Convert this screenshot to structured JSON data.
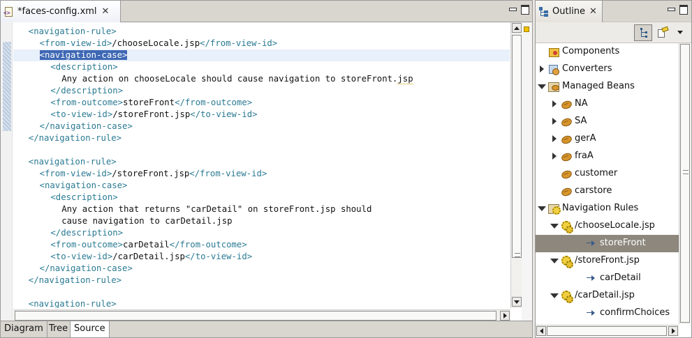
{
  "editor": {
    "tab_title": "*faces-config.xml",
    "bottom_tabs": [
      "Diagram",
      "Tree",
      "Source"
    ],
    "active_bottom_tab": "Source",
    "lines": [
      {
        "indent": 1,
        "parts": [
          [
            "t",
            "<navigation-rule>"
          ]
        ]
      },
      {
        "indent": 2,
        "parts": [
          [
            "t",
            "<from-view-id>"
          ],
          [
            "v",
            "/chooseLocale.jsp"
          ],
          [
            "t",
            "</from-view-id>"
          ]
        ]
      },
      {
        "indent": 2,
        "current": true,
        "parts": [
          [
            "sel",
            "<navigation-case>"
          ]
        ]
      },
      {
        "indent": 3,
        "parts": [
          [
            "t",
            "<description>"
          ]
        ]
      },
      {
        "indent": 4,
        "parts": [
          [
            "v",
            "Any action on chooseLocale should cause navigation to storeFront."
          ],
          [
            "squig",
            "jsp"
          ]
        ]
      },
      {
        "indent": 3,
        "parts": [
          [
            "t",
            "</description>"
          ]
        ]
      },
      {
        "indent": 3,
        "parts": [
          [
            "t",
            "<from-outcome>"
          ],
          [
            "v",
            "storeFront"
          ],
          [
            "t",
            "</from-outcome>"
          ]
        ]
      },
      {
        "indent": 3,
        "parts": [
          [
            "t",
            "<to-view-id>"
          ],
          [
            "v",
            "/storeFront.jsp"
          ],
          [
            "t",
            "</to-view-id>"
          ]
        ]
      },
      {
        "indent": 2,
        "parts": [
          [
            "t",
            "</navigation-case>"
          ]
        ]
      },
      {
        "indent": 1,
        "parts": [
          [
            "t",
            "</navigation-rule>"
          ]
        ]
      },
      {
        "indent": 0,
        "parts": []
      },
      {
        "indent": 1,
        "parts": [
          [
            "t",
            "<navigation-rule>"
          ]
        ]
      },
      {
        "indent": 2,
        "parts": [
          [
            "t",
            "<from-view-id>"
          ],
          [
            "v",
            "/storeFront.jsp"
          ],
          [
            "t",
            "</from-view-id>"
          ]
        ]
      },
      {
        "indent": 2,
        "parts": [
          [
            "t",
            "<navigation-case>"
          ]
        ]
      },
      {
        "indent": 3,
        "parts": [
          [
            "t",
            "<description>"
          ]
        ]
      },
      {
        "indent": 4,
        "parts": [
          [
            "v",
            "Any action that returns \"carDetail\" on storeFront.jsp should"
          ]
        ]
      },
      {
        "indent": 4,
        "parts": [
          [
            "v",
            "cause navigation to carDetail.jsp"
          ]
        ]
      },
      {
        "indent": 3,
        "parts": [
          [
            "t",
            "</description>"
          ]
        ]
      },
      {
        "indent": 3,
        "parts": [
          [
            "t",
            "<from-outcome>"
          ],
          [
            "v",
            "carDetail"
          ],
          [
            "t",
            "</from-outcome>"
          ]
        ]
      },
      {
        "indent": 3,
        "parts": [
          [
            "t",
            "<to-view-id>"
          ],
          [
            "v",
            "/carDetail.jsp"
          ],
          [
            "t",
            "</to-view-id>"
          ]
        ]
      },
      {
        "indent": 2,
        "parts": [
          [
            "t",
            "</navigation-case>"
          ]
        ]
      },
      {
        "indent": 1,
        "parts": [
          [
            "t",
            "</navigation-rule>"
          ]
        ]
      },
      {
        "indent": 0,
        "parts": []
      },
      {
        "indent": 1,
        "parts": [
          [
            "t",
            "<navigation-rule>"
          ]
        ]
      }
    ]
  },
  "outline": {
    "tab_title": "Outline",
    "tree": [
      {
        "depth": 0,
        "twisty": "none",
        "icon": "components-icon",
        "label": "Components"
      },
      {
        "depth": 0,
        "twisty": "closed",
        "icon": "converters-icon",
        "label": "Converters"
      },
      {
        "depth": 0,
        "twisty": "open",
        "icon": "managed-beans-icon",
        "label": "Managed Beans"
      },
      {
        "depth": 1,
        "twisty": "closed",
        "icon": "bean-icon",
        "label": "NA"
      },
      {
        "depth": 1,
        "twisty": "closed",
        "icon": "bean-icon",
        "label": "SA"
      },
      {
        "depth": 1,
        "twisty": "closed",
        "icon": "bean-icon",
        "label": "gerA"
      },
      {
        "depth": 1,
        "twisty": "closed",
        "icon": "bean-icon",
        "label": "fraA"
      },
      {
        "depth": 1,
        "twisty": "none",
        "icon": "bean-icon",
        "label": "customer"
      },
      {
        "depth": 1,
        "twisty": "none",
        "icon": "bean-icon",
        "label": "carstore"
      },
      {
        "depth": 0,
        "twisty": "open",
        "icon": "navigation-rules-icon",
        "label": "Navigation Rules"
      },
      {
        "depth": 1,
        "twisty": "open",
        "icon": "rule-gear-icon",
        "label": "/chooseLocale.jsp"
      },
      {
        "depth": 2,
        "twisty": "none",
        "icon": "case-arrow-icon",
        "label": "storeFront",
        "selected": true
      },
      {
        "depth": 1,
        "twisty": "open",
        "icon": "rule-gear-icon",
        "label": "/storeFront.jsp"
      },
      {
        "depth": 2,
        "twisty": "none",
        "icon": "case-arrow-icon",
        "label": "carDetail"
      },
      {
        "depth": 1,
        "twisty": "open",
        "icon": "rule-gear-icon",
        "label": "/carDetail.jsp"
      },
      {
        "depth": 2,
        "twisty": "none",
        "icon": "case-arrow-icon",
        "label": "confirmChoices"
      }
    ]
  }
}
